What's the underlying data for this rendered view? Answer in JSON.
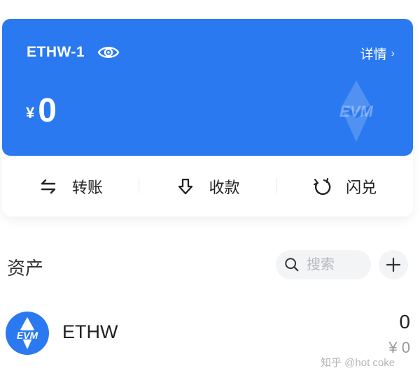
{
  "wallet": {
    "name": "ETHW-1",
    "details_label": "详情",
    "currency_symbol": "¥",
    "balance": "0",
    "accent_color": "#2a79f0",
    "watermark_icon": "evm-logo-icon"
  },
  "actions": [
    {
      "label": "转账",
      "icon": "transfer-arrows-icon"
    },
    {
      "label": "收款",
      "icon": "receive-download-icon"
    },
    {
      "label": "闪兑",
      "icon": "swap-cycle-icon"
    }
  ],
  "assets_section": {
    "title": "资产",
    "search_placeholder": "搜索",
    "add_icon": "plus-icon"
  },
  "assets": [
    {
      "name": "ETHW",
      "quantity": "0",
      "fiat_value": "¥ 0",
      "icon": "evm-token-icon"
    }
  ],
  "page_watermark": "知乎 @hot coke"
}
